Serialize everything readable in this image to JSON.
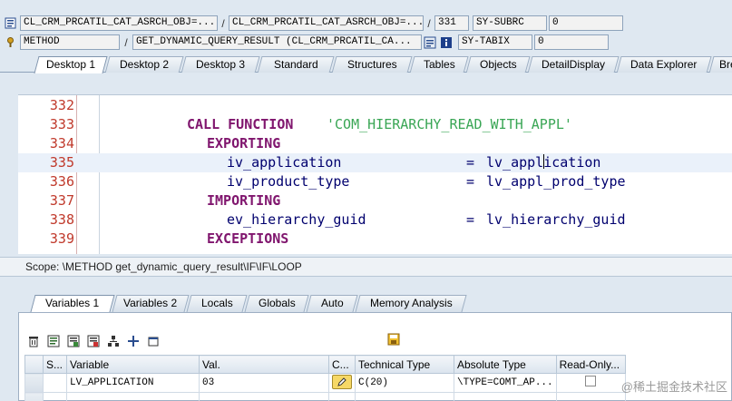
{
  "info": {
    "row1": {
      "program": "CL_CRM_PRCATIL_CAT_ASRCH_OBJ=...",
      "include": "CL_CRM_PRCATIL_CAT_ASRCH_OBJ=...",
      "line": "331",
      "var_name": "SY-SUBRC",
      "var_value": "0"
    },
    "row2": {
      "event_type": "METHOD",
      "event": "GET_DYNAMIC_QUERY_RESULT (CL_CRM_PRCATIL_CA...",
      "var_name": "SY-TABIX",
      "var_value": "0"
    },
    "separator": "/"
  },
  "desktop_tabs": [
    "Desktop 1",
    "Desktop 2",
    "Desktop 3",
    "Standard",
    "Structures",
    "Tables",
    "Objects",
    "DetailDisplay",
    "Data Explorer",
    "Bre"
  ],
  "code_lines": [
    {
      "num": "332"
    },
    {
      "num": "333",
      "kw": "CALL FUNCTION",
      "str": "'COM_HIERARCHY_READ_WITH_APPL'"
    },
    {
      "num": "334",
      "kw": "EXPORTING"
    },
    {
      "num": "335",
      "param": "iv_application",
      "eq": "=",
      "val_a": "lv_appl",
      "val_b": "ication"
    },
    {
      "num": "336",
      "param": "iv_product_type",
      "eq": "=",
      "val": "lv_appl_prod_type"
    },
    {
      "num": "337",
      "kw": "IMPORTING"
    },
    {
      "num": "338",
      "param": "ev_hierarchy_guid",
      "eq": "=",
      "val": "lv_hierarchy_guid"
    },
    {
      "num": "339",
      "kw": "EXCEPTIONS"
    }
  ],
  "scope": "Scope: \\METHOD get_dynamic_query_result\\IF\\IF\\LOOP",
  "variable_tabs": [
    "Variables 1",
    "Variables 2",
    "Locals",
    "Globals",
    "Auto",
    "Memory Analysis"
  ],
  "grid": {
    "headers": [
      "S...",
      "Variable",
      "Val.",
      "C...",
      "Technical Type",
      "Absolute Type",
      "Read-Only..."
    ],
    "rows": [
      {
        "variable": "LV_APPLICATION",
        "value": "03",
        "technical_type": "C(20)",
        "absolute_type": "\\TYPE=COMT_AP..."
      }
    ]
  },
  "watermark": "@稀土掘金技术社区",
  "colors": {
    "keyword": "#80166e",
    "string": "#3aa655",
    "identifier": "#00006e",
    "line_number": "#c0392b"
  }
}
